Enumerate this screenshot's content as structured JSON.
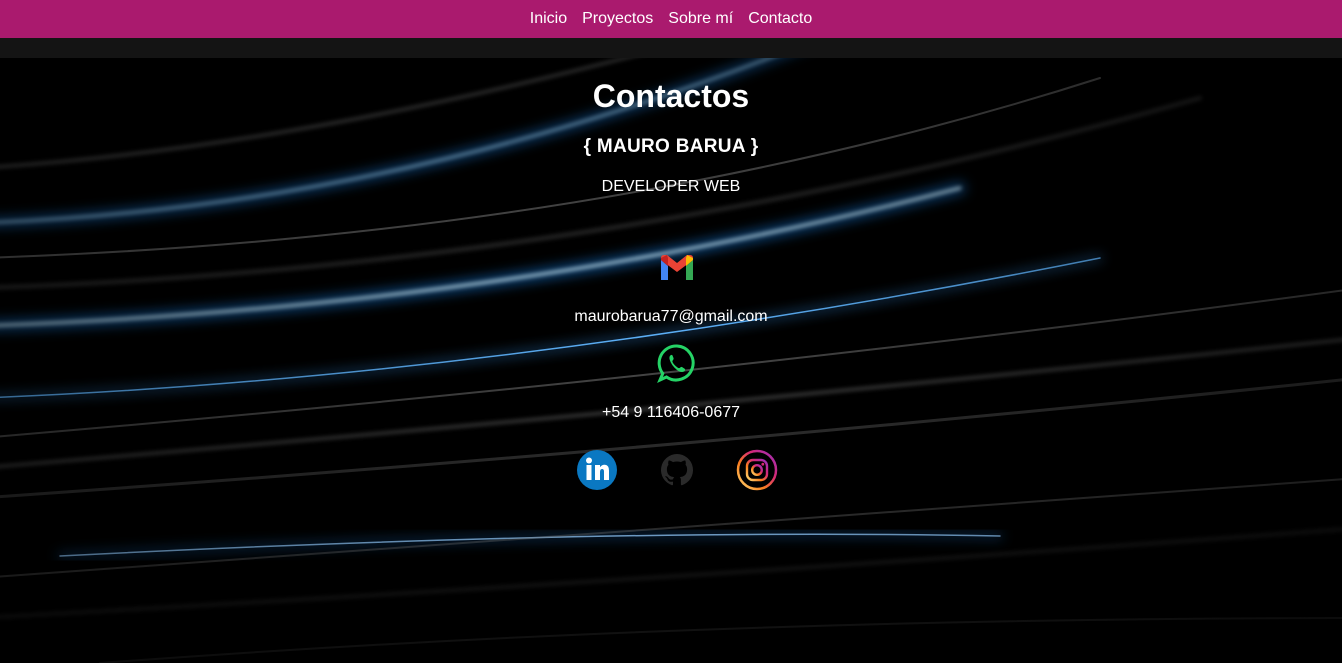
{
  "nav": {
    "items": [
      {
        "label": "Inicio"
      },
      {
        "label": "Proyectos"
      },
      {
        "label": "Sobre mí"
      },
      {
        "label": "Contacto"
      }
    ]
  },
  "contact": {
    "title": "Contactos",
    "name": "{ MAURO BARUA }",
    "role": "DEVELOPER WEB",
    "email": "maurobarua77@gmail.com",
    "phone": "+54 9 116406-0677",
    "icons": [
      "gmail-icon",
      "whatsapp-icon",
      "linkedin-icon",
      "github-icon",
      "instagram-icon"
    ]
  },
  "colors": {
    "nav_bg": "#aa1a6e",
    "page_bg": "#000000",
    "accent_blue": "#1e90ff",
    "whatsapp": "#25d366",
    "linkedin": "#0a78c2"
  }
}
